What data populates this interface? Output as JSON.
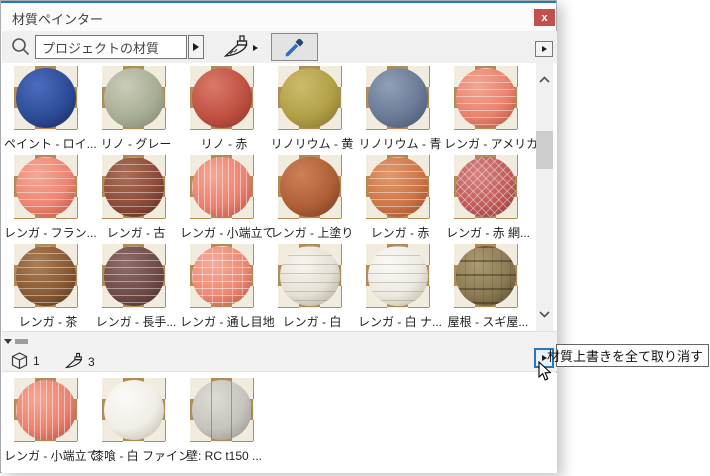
{
  "window": {
    "title": "材質ペインター",
    "close_label": "x"
  },
  "toolbar": {
    "search_value": "プロジェクトの材質"
  },
  "grid": {
    "items": [
      {
        "label": "ペイント - ロイ...",
        "base": "#2e4c97",
        "hi": "#4b6cc0",
        "dark": "#16265c",
        "pattern": "plain"
      },
      {
        "label": "リノ - グレー",
        "base": "#a9ae96",
        "hi": "#c9cdb9",
        "dark": "#7b816b",
        "pattern": "plain"
      },
      {
        "label": "リノ - 赤",
        "base": "#c05143",
        "hi": "#da7a69",
        "dark": "#8a3124",
        "pattern": "plain"
      },
      {
        "label": "リノリウム - 黄",
        "base": "#b2a047",
        "hi": "#ccbc6c",
        "dark": "#7d6d28",
        "pattern": "plain"
      },
      {
        "label": "リノリウム - 青",
        "base": "#6b7a95",
        "hi": "#91a0b8",
        "dark": "#434f68",
        "pattern": "plain"
      },
      {
        "label": "レンガ - アメリカ...",
        "base": "#e8826d",
        "hi": "#f4a694",
        "dark": "#aa4a36",
        "pattern": "brick"
      },
      {
        "label": "レンガ - フラン...",
        "base": "#ee8472",
        "hi": "#f7a898",
        "dark": "#b04c3a",
        "pattern": "brick"
      },
      {
        "label": "レンガ - 古",
        "base": "#8c4c39",
        "hi": "#ab6f58",
        "dark": "#57291b",
        "pattern": "brick"
      },
      {
        "label": "レンガ - 小端立て",
        "base": "#ec8270",
        "hi": "#f6a795",
        "dark": "#ad4b38",
        "pattern": "vertical"
      },
      {
        "label": "レンガ - 上塗り",
        "base": "#b06038",
        "hi": "#cd8157",
        "dark": "#73381b",
        "pattern": "plain"
      },
      {
        "label": "レンガ - 赤",
        "base": "#cd7647",
        "hi": "#e29a6d",
        "dark": "#8f4722",
        "pattern": "brick"
      },
      {
        "label": "レンガ - 赤 網...",
        "base": "#c05c5a",
        "hi": "#d68180",
        "dark": "#853433",
        "pattern": "herringbone"
      },
      {
        "label": "レンガ - 茶",
        "base": "#8a5a35",
        "hi": "#a97e55",
        "dark": "#55311a",
        "pattern": "brick"
      },
      {
        "label": "レンガ - 長手...",
        "base": "#6f4c49",
        "hi": "#8f6d69",
        "dark": "#452927",
        "pattern": "brick"
      },
      {
        "label": "レンガ - 通し目地",
        "base": "#ee8973",
        "hi": "#f8ab9a",
        "dark": "#b1503a",
        "pattern": "grid"
      },
      {
        "label": "レンガ - 白",
        "base": "#e5e1d6",
        "hi": "#f7f5ee",
        "dark": "#a9a393",
        "pattern": "brick-light"
      },
      {
        "label": "レンガ - 白 ナ...",
        "base": "#edeae2",
        "hi": "#fbfaf6",
        "dark": "#b4aea0",
        "pattern": "brick-light"
      },
      {
        "label": "屋根 - スギ屋...",
        "base": "#8c7b54",
        "hi": "#ab9a72",
        "dark": "#54472b",
        "pattern": "wood"
      }
    ]
  },
  "overrides_bar": {
    "surface_count": "1",
    "painted_count": "3",
    "tooltip": "材質上書きを全て取り消す"
  },
  "applied": {
    "items": [
      {
        "label": "レンガ - 小端立て",
        "base": "#ec8270",
        "hi": "#f6a795",
        "dark": "#ad4b38",
        "pattern": "vertical"
      },
      {
        "label": "漆喰 - 白 ファイン",
        "base": "#f0ede6",
        "hi": "#fcfbf8",
        "dark": "#b8b2a4",
        "pattern": "plain"
      },
      {
        "label": "壁: RC t150 ...",
        "base": "#c7c4bd",
        "hi": "#dedbd5",
        "dark": "#8f8c85",
        "pattern": "seam"
      }
    ]
  },
  "colors": {
    "accent": "#2778be",
    "close_red": "#c4504e",
    "toolbar_bg": "#f0f0f0"
  }
}
